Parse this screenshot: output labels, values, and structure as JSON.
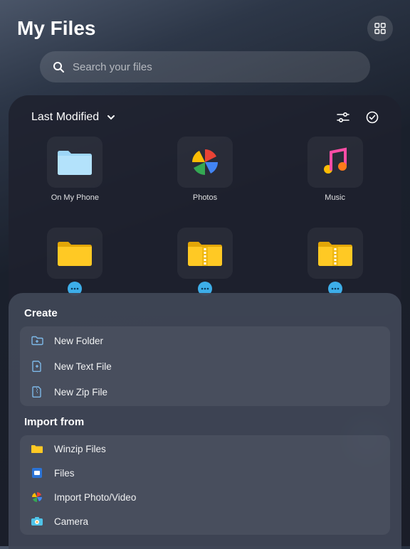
{
  "header": {
    "title": "My Files"
  },
  "search": {
    "placeholder": "Search your files"
  },
  "sort": {
    "label": "Last Modified"
  },
  "tiles": {
    "row1": [
      {
        "label": "On My Phone"
      },
      {
        "label": "Photos"
      },
      {
        "label": "Music"
      }
    ]
  },
  "create": {
    "title": "Create",
    "items": [
      {
        "label": "New Folder"
      },
      {
        "label": "New Text File"
      },
      {
        "label": "New Zip File"
      }
    ]
  },
  "import": {
    "title": "Import from",
    "items": [
      {
        "label": "Winzip Files"
      },
      {
        "label": "Files"
      },
      {
        "label": "Import Photo/Video"
      },
      {
        "label": "Camera"
      }
    ]
  }
}
